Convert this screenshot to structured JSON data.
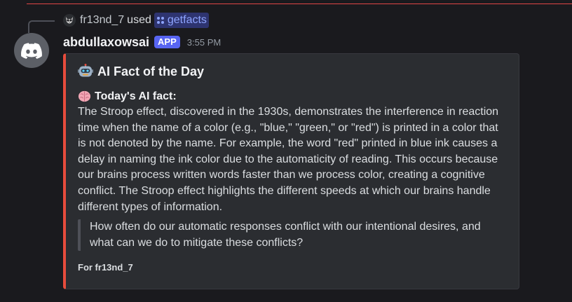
{
  "reply": {
    "username": "fr13nd_7",
    "used_text": "used",
    "command": "getfacts",
    "avatar_icon": "owl-avatar-icon",
    "command_icon": "app-command-icon"
  },
  "message": {
    "author": "abdullaxowsai",
    "badge": "APP",
    "timestamp": "3:55 PM",
    "avatar_icon": "discord-logo-icon"
  },
  "embed": {
    "accent_color": "#e74c3c",
    "title_emoji": "robot-emoji-icon",
    "title": "AI Fact of the Day",
    "fact_emoji": "brain-emoji-icon",
    "fact_heading": "Today's AI fact:",
    "fact_body": "The Stroop effect, discovered in the 1930s, demonstrates the interference in reaction time when the name of a color (e.g., \"blue,\" \"green,\" or \"red\") is printed in a color that is not denoted by the name. For example, the word \"red\" printed in blue ink causes a delay in naming the ink color due to the automaticity of reading. This occurs because our brains process written words faster than we process color, creating a cognitive conflict. The Stroop effect highlights the different speeds at which our brains handle different types of information.",
    "quote": "How often do our automatic responses conflict with our intentional desires, and what can we do to mitigate these conflicts?",
    "footer": "For fr13nd_7"
  },
  "colors": {
    "background": "#1a1a1e",
    "embed_background": "#2b2d31",
    "app_badge": "#5865f2",
    "command_link": "#8da4ff",
    "new_messages_line": "#e04545"
  }
}
